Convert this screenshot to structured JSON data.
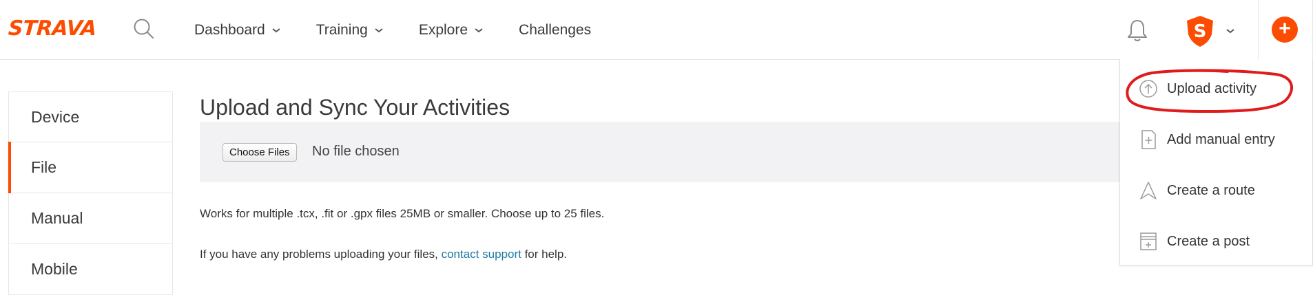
{
  "brand": {
    "logo_text": "STRAVA",
    "accent": "#fc4c02"
  },
  "nav": {
    "items": [
      {
        "label": "Dashboard",
        "has_dropdown": true
      },
      {
        "label": "Training",
        "has_dropdown": true
      },
      {
        "label": "Explore",
        "has_dropdown": true
      },
      {
        "label": "Challenges",
        "has_dropdown": false
      }
    ]
  },
  "header_icons": {
    "search": "search-icon",
    "notifications": "bell-icon",
    "avatar": "shield-s-avatar",
    "add": "plus-icon",
    "add_symbol": "+"
  },
  "side_tabs": [
    {
      "label": "Device",
      "active": false
    },
    {
      "label": "File",
      "active": true
    },
    {
      "label": "Manual",
      "active": false
    },
    {
      "label": "Mobile",
      "active": false
    }
  ],
  "main": {
    "title": "Upload and Sync Your Activities",
    "choose_button": "Choose Files",
    "no_file_text": "No file chosen",
    "info_line": "Works for multiple .tcx, .fit or .gpx files 25MB or smaller. Choose up to 25 files.",
    "help_prefix": "If you have any problems uploading your files, ",
    "help_link": "contact support",
    "help_suffix": " for help."
  },
  "dropdown": {
    "items": [
      {
        "label": "Upload activity",
        "icon": "upload-icon",
        "highlighted": true
      },
      {
        "label": "Add manual entry",
        "icon": "add-entry-icon"
      },
      {
        "label": "Create a route",
        "icon": "route-icon"
      },
      {
        "label": "Create a post",
        "icon": "post-icon"
      }
    ]
  }
}
